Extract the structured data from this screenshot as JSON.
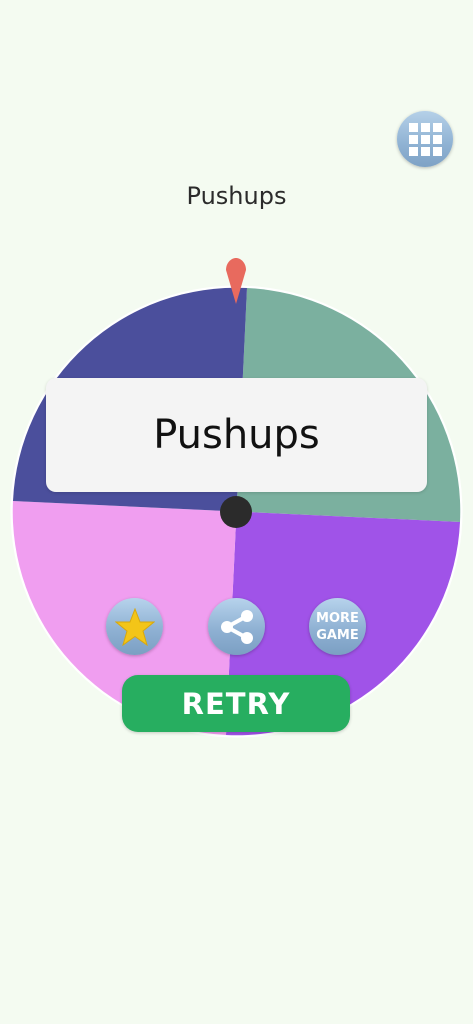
{
  "game": {
    "title": "Pushups",
    "result": "Pushups"
  },
  "wheel": {
    "segments": [
      {
        "color": "#7bb09f"
      },
      {
        "color": "#a053e8"
      },
      {
        "color": "#f09ef0"
      },
      {
        "color": "#4b4f9c"
      }
    ],
    "pointer_color": "#e86a5e",
    "hub_color": "#2b2b2b"
  },
  "buttons": {
    "menu_icon": "grid-icon",
    "rate_icon": "star-icon",
    "share_icon": "share-icon",
    "more_label_line1": "MORE",
    "more_label_line2": "GAME",
    "retry_label": "RETRY"
  }
}
